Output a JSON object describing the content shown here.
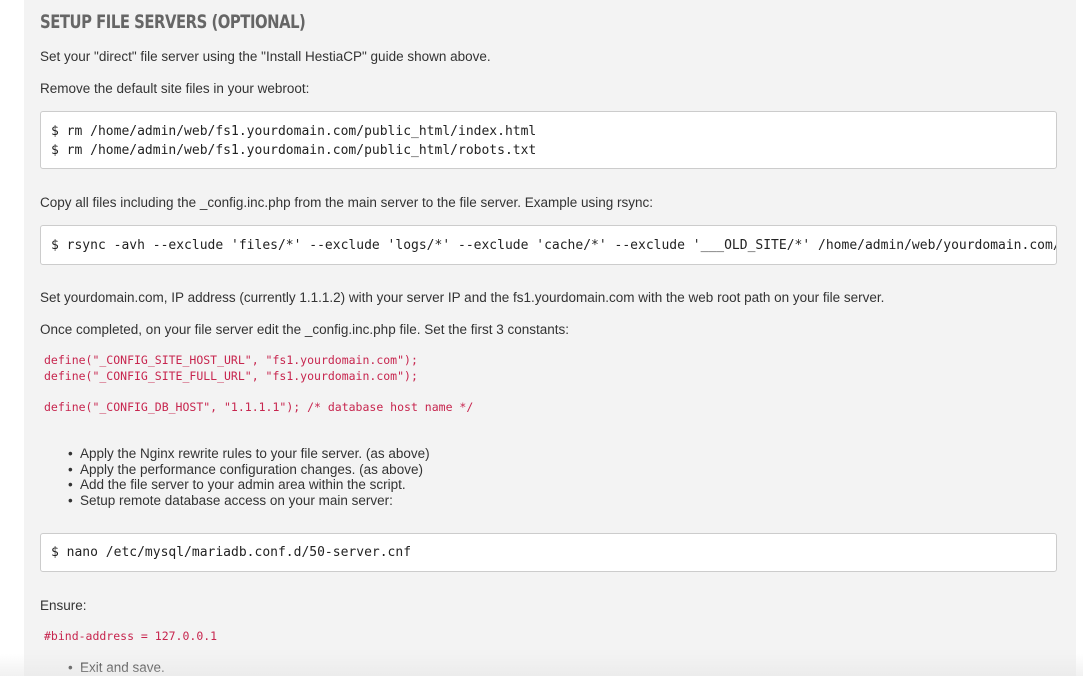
{
  "section": {
    "title": "Setup File Servers (optional)"
  },
  "paragraphs": {
    "direct": "Set your \"direct\" file server using the \"Install HestiaCP\" guide shown above.",
    "remove": "Remove the default site files in your webroot:",
    "copy": "Copy all files including the _config.inc.php from the main server to the file server. Example using rsync:",
    "set_domain": "Set yourdomain.com, IP address (currently 1.1.1.2) with your server IP and the fs1.yourdomain.com with the web root path on your file server.",
    "once": "Once completed, on your file server edit the _config.inc.php file. Set the first 3 constants:",
    "ensure": "Ensure:"
  },
  "code_blocks": {
    "rm_line1": "$ rm /home/admin/web/fs1.yourdomain.com/public_html/index.html",
    "rm_line2": "$ rm /home/admin/web/fs1.yourdomain.com/public_html/robots.txt",
    "rsync": "$ rsync -avh --exclude 'files/*' --exclude 'logs/*' --exclude 'cache/*' --exclude '___OLD_SITE/*' /home/admin/web/yourdomain.com/",
    "nano": "$ nano /etc/mysql/mariadb.conf.d/50-server.cnf"
  },
  "inline_code": {
    "host_url": "define(\"_CONFIG_SITE_HOST_URL\", \"fs1.yourdomain.com\");",
    "full_url": "define(\"_CONFIG_SITE_FULL_URL\", \"fs1.yourdomain.com\");",
    "db_host": "define(\"_CONFIG_DB_HOST\", \"1.1.1.1\"); /* database host name */",
    "bind": "#bind-address = 127.0.0.1"
  },
  "bullets": [
    "Apply the Nginx rewrite rules to your file server. (as above)",
    "Apply the performance configuration changes. (as above)",
    "Add the file server to your admin area within the script.",
    "Setup remote database access on your main server:"
  ],
  "bullets2": [
    "Exit and save."
  ],
  "bullet_glyph": "•"
}
